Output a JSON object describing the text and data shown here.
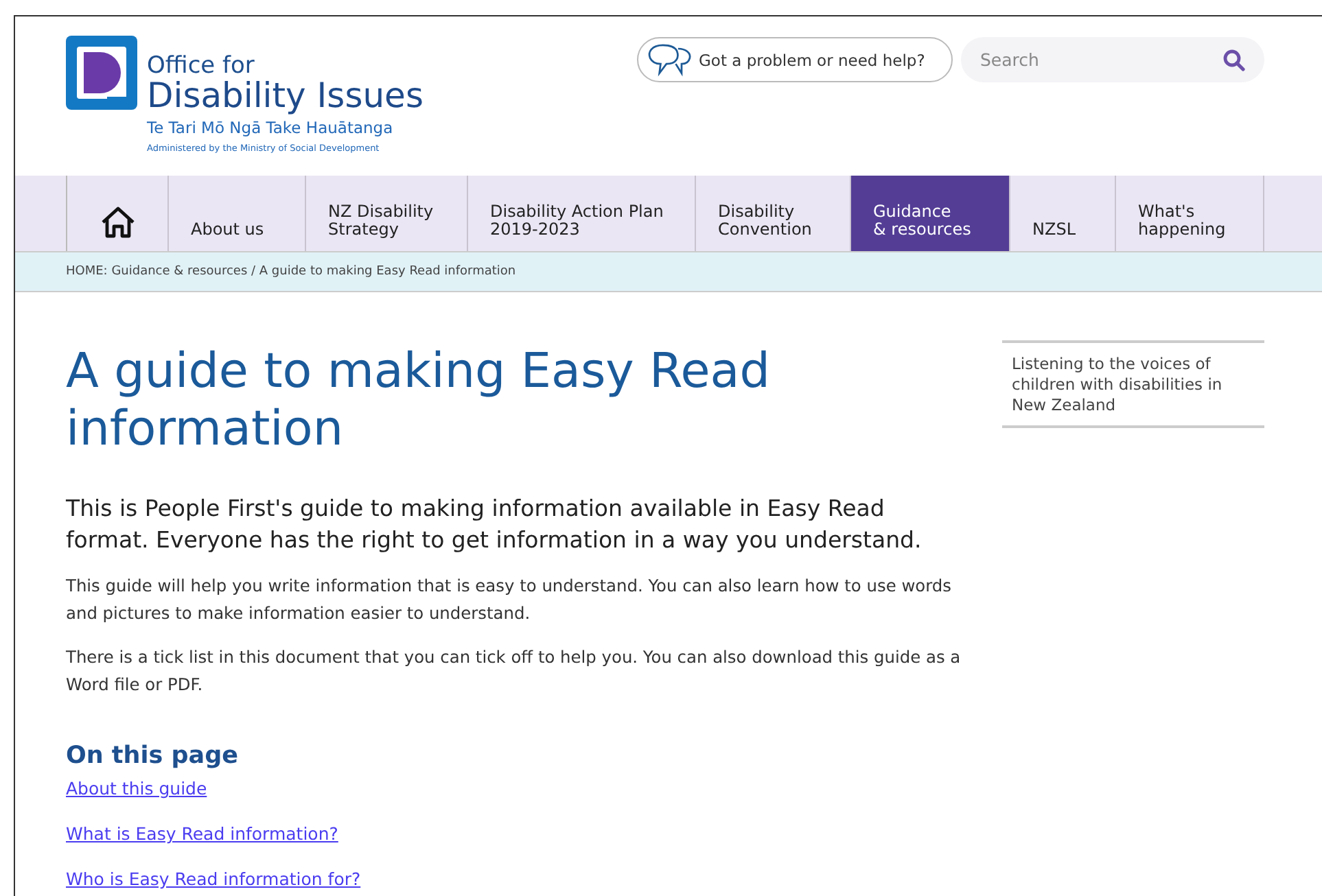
{
  "logo": {
    "line_1": "Office for",
    "line_2": "Disability Issues",
    "maori_name": "Te Tari Mō Ngā Take Hauātanga",
    "tagline": "Administered by the Ministry of  Social Development"
  },
  "help_button": {
    "label": "Got a problem or need help?"
  },
  "search": {
    "placeholder": "Search"
  },
  "nav": [
    {
      "kind": "home",
      "selected": false
    },
    {
      "kind": "text",
      "label": "About us",
      "selected": false
    },
    {
      "kind": "text",
      "label": "NZ Disability\nStrategy",
      "selected": false
    },
    {
      "kind": "text",
      "label": "Disability Action Plan\n2019-2023",
      "selected": false
    },
    {
      "kind": "text",
      "label": "Disability\nConvention",
      "selected": false
    },
    {
      "kind": "text",
      "label": "Guidance\n& resources",
      "selected": true
    },
    {
      "kind": "text",
      "label": "NZSL",
      "selected": false
    },
    {
      "kind": "text",
      "label": "What's\nhappening",
      "selected": false
    }
  ],
  "breadcrumb": "HOME: Guidance & resources / A guide to making Easy Read information",
  "title": "A guide to making Easy Read information",
  "lead": "This is People First's guide to making information available in Easy Read format. Everyone has the right to get information in a way you understand.",
  "paragraphs": [
    "This guide will help you write information that is easy to understand. You can also learn how to use words and pictures to make information easier to understand.",
    "There is a tick list in this document that you can tick off to help you. You can also download this guide as a Word file or PDF."
  ],
  "on_this_page": {
    "heading": "On this page",
    "links": [
      "About this guide",
      "What is Easy Read information?",
      "Who is Easy Read information for?"
    ]
  },
  "sidebar_link": "Listening to the voices of children with disabilities in New Zealand"
}
